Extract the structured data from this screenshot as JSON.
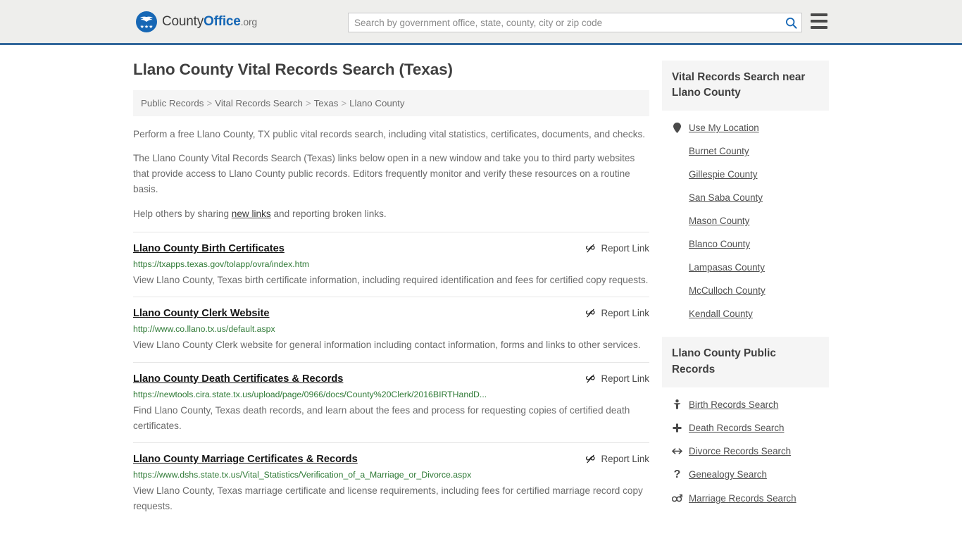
{
  "header": {
    "logo": {
      "part1": "County",
      "part2": "Office",
      "part3": ".org",
      "stars": "★★★",
      "icon": "eagle-shield-logo"
    },
    "search": {
      "placeholder": "Search by government office, state, county, city or zip code",
      "value": "",
      "icon": "search-icon"
    },
    "menu_icon": "hamburger-menu-icon",
    "accent_color": "#33689c",
    "background_color": "#eeeeec"
  },
  "main": {
    "title": "Llano County Vital Records Search (Texas)",
    "breadcrumb": [
      {
        "label": "Public Records"
      },
      {
        "label": "Vital Records Search"
      },
      {
        "label": "Texas"
      },
      {
        "label": "Llano County"
      }
    ],
    "breadcrumb_separator": ">",
    "intro": {
      "p1": "Perform a free Llano County, TX public vital records search, including vital statistics, certificates, documents, and checks.",
      "p2": "The Llano County Vital Records Search (Texas) links below open in a new window and take you to third party websites that provide access to Llano County public records. Editors frequently monitor and verify these resources on a routine basis.",
      "p3_before": "Help others by sharing ",
      "p3_link": "new links",
      "p3_after": " and reporting broken links."
    },
    "report_link_label": "Report Link",
    "report_link_icon": "broken-link-icon",
    "results": [
      {
        "title": "Llano County Birth Certificates",
        "url": "https://txapps.texas.gov/tolapp/ovra/index.htm",
        "description": "View Llano County, Texas birth certificate information, including required identification and fees for certified copy requests."
      },
      {
        "title": "Llano County Clerk Website",
        "url": "http://www.co.llano.tx.us/default.aspx",
        "description": "View Llano County Clerk website for general information including contact information, forms and links to other services."
      },
      {
        "title": "Llano County Death Certificates & Records",
        "url": "https://newtools.cira.state.tx.us/upload/page/0966/docs/County%20Clerk/2016BIRTHandD...",
        "description": "Find Llano County, Texas death records, and learn about the fees and process for requesting copies of certified death certificates."
      },
      {
        "title": "Llano County Marriage Certificates & Records",
        "url": "https://www.dshs.state.tx.us/Vital_Statistics/Verification_of_a_Marriage_or_Divorce.aspx",
        "description": "View Llano County, Texas marriage certificate and license requirements, including fees for certified marriage record copy requests."
      }
    ]
  },
  "sidebar": {
    "nearby": {
      "heading": "Vital Records Search near Llano County",
      "items": [
        {
          "label": "Use My Location",
          "icon": "map-pin-icon",
          "glyph": "•"
        },
        {
          "label": "Burnet County",
          "icon": "",
          "glyph": ""
        },
        {
          "label": "Gillespie County",
          "icon": "",
          "glyph": ""
        },
        {
          "label": "San Saba County",
          "icon": "",
          "glyph": ""
        },
        {
          "label": "Mason County",
          "icon": "",
          "glyph": ""
        },
        {
          "label": "Blanco County",
          "icon": "",
          "glyph": ""
        },
        {
          "label": "Lampasas County",
          "icon": "",
          "glyph": ""
        },
        {
          "label": "McCulloch County",
          "icon": "",
          "glyph": ""
        },
        {
          "label": "Kendall County",
          "icon": "",
          "glyph": ""
        }
      ]
    },
    "public_records": {
      "heading": "Llano County Public Records",
      "items": [
        {
          "label": "Birth Records Search",
          "icon": "baby-icon",
          "glyph": "Ѧ"
        },
        {
          "label": "Death Records Search",
          "icon": "cross-icon",
          "glyph": "✚"
        },
        {
          "label": "Divorce Records Search",
          "icon": "left-right-arrow-icon",
          "glyph": "↔"
        },
        {
          "label": "Genealogy Search",
          "icon": "question-mark-icon",
          "glyph": "?"
        },
        {
          "label": "Marriage Records Search",
          "icon": "male-female-icon",
          "glyph": "⚥"
        }
      ]
    }
  }
}
